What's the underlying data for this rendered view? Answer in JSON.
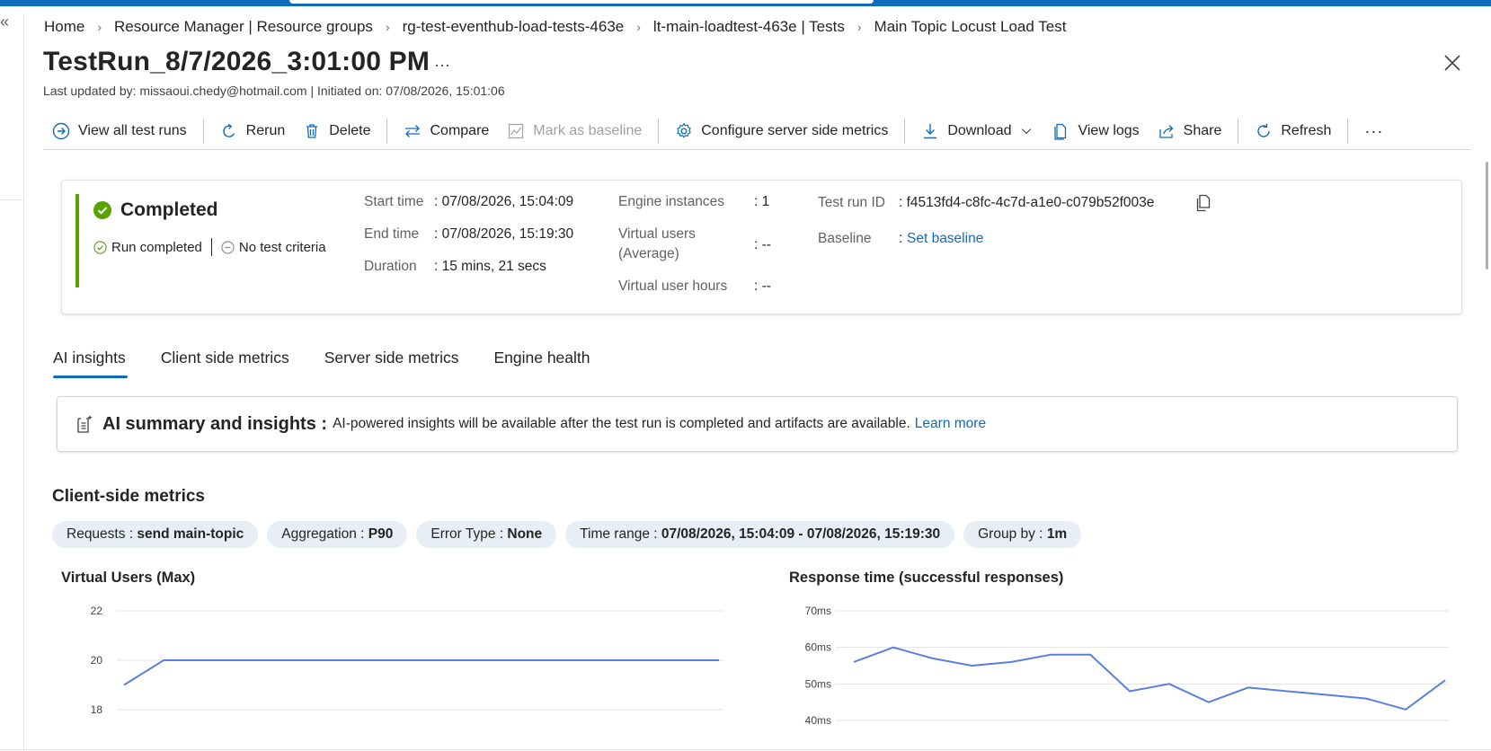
{
  "breadcrumb": {
    "items": [
      "Home",
      "Resource Manager | Resource groups",
      "rg-test-eventhub-load-tests-463e",
      "lt-main-loadtest-463e | Tests",
      "Main Topic Locust Load Test"
    ]
  },
  "header": {
    "title": "TestRun_8/7/2026_3:01:00 PM",
    "more": "···",
    "subtitle": "Last updated by: missaoui.chedy@hotmail.com | Initiated on: 07/08/2026, 15:01:06"
  },
  "toolbar": {
    "view_all": "View all test runs",
    "rerun": "Rerun",
    "delete": "Delete",
    "compare": "Compare",
    "mark_baseline": "Mark as baseline",
    "configure": "Configure server side metrics",
    "download": "Download",
    "view_logs": "View logs",
    "share": "Share",
    "refresh": "Refresh",
    "more": "···"
  },
  "status": {
    "title": "Completed",
    "run_completed": "Run completed",
    "criteria": "No test criteria",
    "start_label": "Start time",
    "start_value": ": 07/08/2026, 15:04:09",
    "end_label": "End time",
    "end_value": ": 07/08/2026, 15:19:30",
    "duration_label": "Duration",
    "duration_value": ": 15 mins, 21 secs",
    "engines_label": "Engine instances",
    "engines_value": ": 1",
    "vu_label_1": "Virtual users",
    "vu_label_2": "(Average)",
    "vu_value": ": --",
    "vuh_label": "Virtual user hours",
    "vuh_value": ": --",
    "run_id_label": "Test run ID",
    "run_id_value": ": f4513fd4-c8fc-4c7d-a1e0-c079b52f003e",
    "baseline_label": "Baseline",
    "baseline_colon": ":",
    "baseline_link": "Set baseline"
  },
  "tabs": [
    "AI insights",
    "Client side metrics",
    "Server side metrics",
    "Engine health"
  ],
  "ai": {
    "heading": "AI summary and insights :",
    "body": "AI-powered insights will be available after the test run is completed and artifacts are available.",
    "link": "Learn more"
  },
  "metrics": {
    "title": "Client-side metrics",
    "filters": [
      {
        "label": "Requests : ",
        "value": "send main-topic"
      },
      {
        "label": "Aggregation : ",
        "value": "P90"
      },
      {
        "label": "Error Type : ",
        "value": "None"
      },
      {
        "label": "Time range : ",
        "value": "07/08/2026, 15:04:09 - 07/08/2026, 15:19:30"
      },
      {
        "label": "Group by : ",
        "value": "1m"
      }
    ]
  },
  "colors": {
    "accent": "#0f6cbd",
    "success": "#57a300",
    "series": "#5b7fe0"
  },
  "chart_data": [
    {
      "type": "line",
      "title": "Virtual Users (Max)",
      "y_ticks": [
        "22",
        "20",
        "18"
      ],
      "ylim": [
        18,
        22
      ],
      "x": [
        1,
        2,
        3,
        4,
        5,
        6,
        7,
        8,
        9,
        10,
        11,
        12,
        13,
        14,
        15,
        16
      ],
      "series": [
        {
          "values": [
            19,
            20,
            20,
            20,
            20,
            20,
            20,
            20,
            20,
            20,
            20,
            20,
            20,
            20,
            20,
            20
          ]
        }
      ]
    },
    {
      "type": "line",
      "title": "Response time (successful responses)",
      "y_ticks": [
        "70ms",
        "60ms",
        "50ms",
        "40ms"
      ],
      "ylim": [
        40,
        70
      ],
      "x": [
        1,
        2,
        3,
        4,
        5,
        6,
        7,
        8,
        9,
        10,
        11,
        12,
        13,
        14,
        15,
        16
      ],
      "series": [
        {
          "values": [
            56,
            60,
            57,
            55,
            56,
            58,
            58,
            48,
            50,
            45,
            49,
            48,
            47,
            46,
            43,
            51
          ]
        }
      ]
    }
  ]
}
